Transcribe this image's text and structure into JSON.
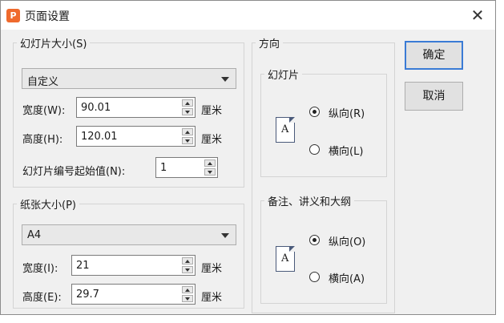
{
  "window": {
    "title": "页面设置",
    "app_icon": "P"
  },
  "slide_size": {
    "legend": "幻灯片大小(S)",
    "preset": "自定义",
    "width_label": "宽度(W):",
    "width_value": "90.01",
    "width_unit": "厘米",
    "height_label": "高度(H):",
    "height_value": "120.01",
    "height_unit": "厘米",
    "start_number_label": "幻灯片编号起始值(N):",
    "start_number_value": "1"
  },
  "paper_size": {
    "legend": "纸张大小(P)",
    "preset": "A4",
    "width_label": "宽度(I):",
    "width_value": "21",
    "width_unit": "厘米",
    "height_label": "高度(E):",
    "height_value": "29.7",
    "height_unit": "厘米"
  },
  "orientation": {
    "legend": "方向",
    "slides": {
      "legend": "幻灯片",
      "portrait": "纵向(R)",
      "landscape": "横向(L)",
      "selected": "portrait",
      "page_letter": "A"
    },
    "notes": {
      "legend": "备注、讲义和大纲",
      "portrait": "纵向(O)",
      "landscape": "横向(A)",
      "selected": "portrait",
      "page_letter": "A"
    }
  },
  "buttons": {
    "ok": "确定",
    "cancel": "取消"
  },
  "icons": {
    "close": "close-icon",
    "dropdown": "chevron-down-icon",
    "spin_up": "caret-up-icon",
    "spin_down": "caret-down-icon",
    "page": "page-portrait-icon"
  },
  "colors": {
    "app_icon": "#ef6a2d",
    "default_button_border": "#3a7bd5",
    "dialog_bg": "#f0f0f0"
  }
}
